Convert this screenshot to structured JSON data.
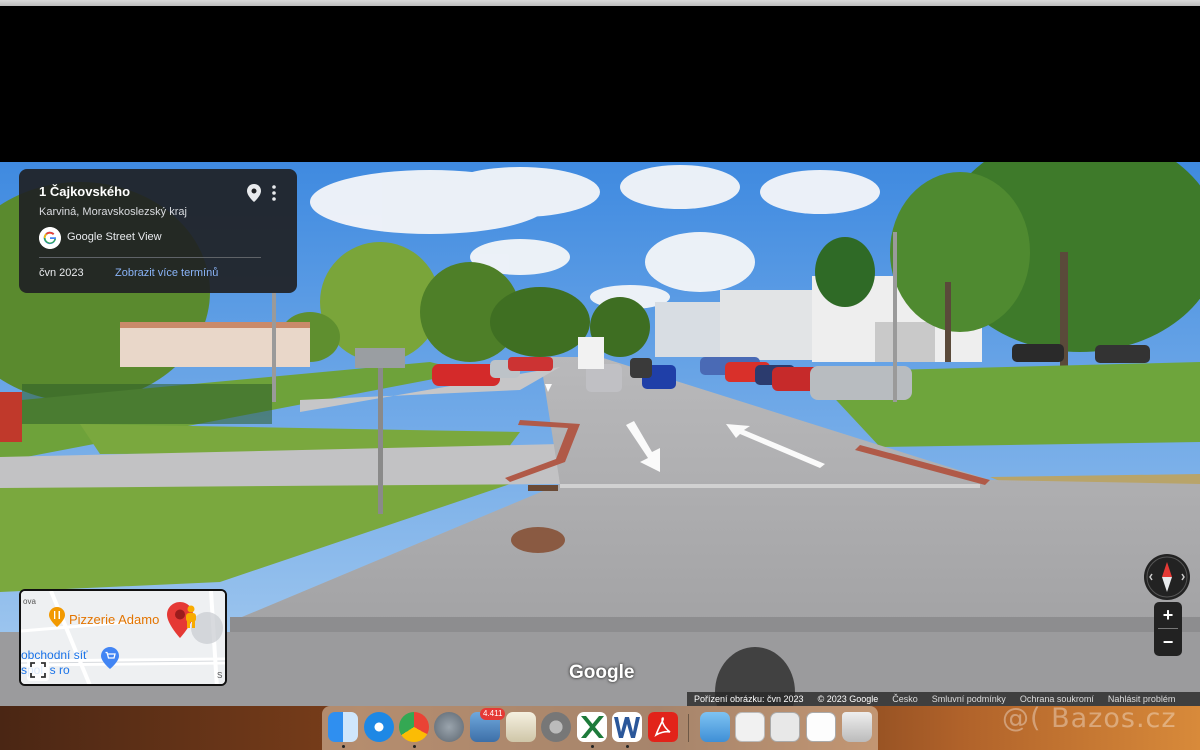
{
  "info_card": {
    "title": "1 Čajkovského",
    "subtitle": "Karviná, Moravskoslezský kraj",
    "brand": "Google Street View",
    "date": "čvn 2023",
    "more_dates": "Zobrazit více termínů"
  },
  "minimap": {
    "poi_restaurant": "Pizzerie Adamo",
    "poi_shop_line1": "obchodní síť",
    "poi_shop_line2": "spol. s ro",
    "street_top": "ova",
    "street_side": "S"
  },
  "zoom": {
    "in_label": "+",
    "out_label": "−"
  },
  "watermark": "Google",
  "attribution": {
    "capture": "Pořízení obrázku: čvn 2023",
    "copyright": "© 2023 Google",
    "country": "Česko",
    "terms": "Smluvní podmínky",
    "privacy": "Ochrana soukromí",
    "report": "Nahlásit problém"
  },
  "dock": {
    "mail_badge": "4.411"
  },
  "site_watermark": "@( Bazos.cz",
  "colors": {
    "card_bg": "#202124",
    "link": "#8ab4f8",
    "poi_orange": "#e37400",
    "poi_blue": "#1a73e8"
  }
}
